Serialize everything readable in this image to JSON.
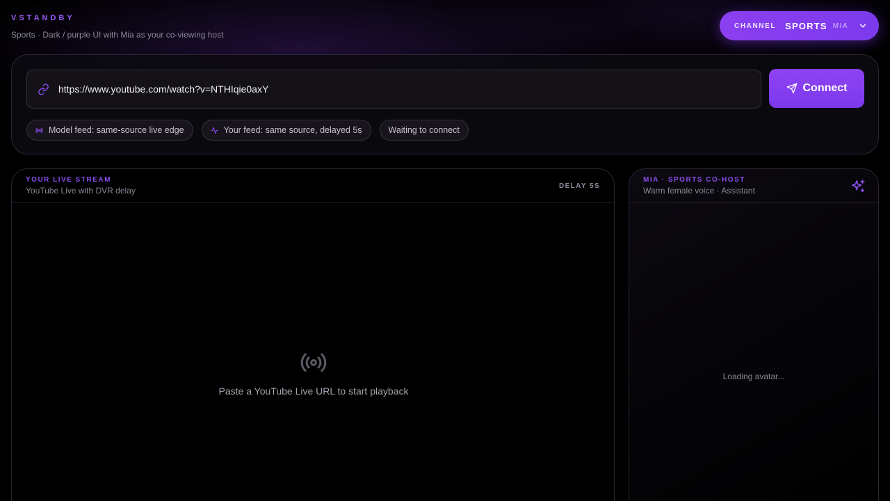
{
  "app": {
    "brand": "VSTANDBY",
    "subtitle": "Sports · Dark / purple UI with Mia as your co-viewing host"
  },
  "channel": {
    "label": "CHANNEL",
    "name": "SPORTS",
    "host": "MIA",
    "icon": "chevron-down-icon"
  },
  "url_bar": {
    "value": "https://www.youtube.com/watch?v=NTHIqie0axY",
    "icon": "link-icon",
    "connect_label": "Connect",
    "connect_icon": "send-icon"
  },
  "chips": [
    {
      "icon": "broadcast-icon",
      "label": "Model feed: same-source live edge"
    },
    {
      "icon": "activity-icon",
      "label": "Your feed: same source, delayed 5s"
    },
    {
      "label": "Waiting to connect"
    }
  ],
  "stream": {
    "title": "YOUR LIVE STREAM",
    "subtitle": "YouTube Live with DVR delay",
    "delay_badge": "DELAY 5S",
    "empty_text": "Paste a YouTube Live URL to start playback",
    "empty_icon": "broadcast-icon"
  },
  "host": {
    "title": "MIA · SPORTS CO-HOST",
    "subtitle": "Warm female voice · Assistant",
    "icon": "sparkles-icon",
    "loading_text": "Loading avatar..."
  },
  "colors": {
    "accent": "#7c3aed",
    "accent_text": "#8b4ef0",
    "background": "#000000"
  }
}
